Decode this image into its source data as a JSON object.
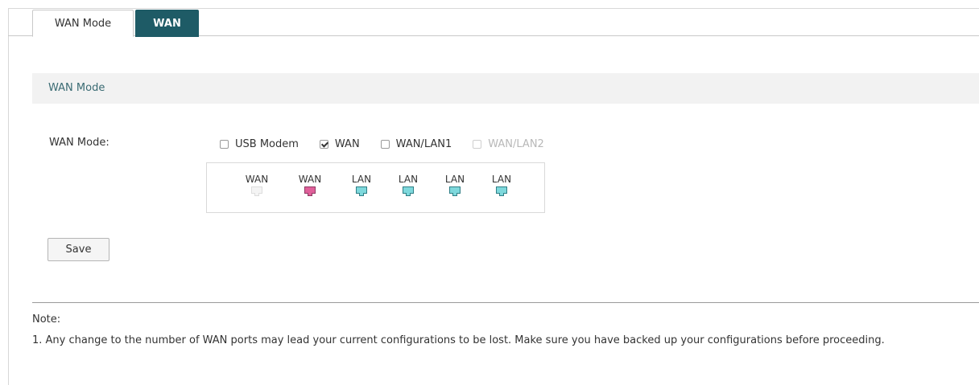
{
  "tabs": [
    {
      "label": "WAN Mode",
      "active": true
    },
    {
      "label": "WAN",
      "active": false
    }
  ],
  "section": {
    "title": "WAN Mode"
  },
  "wan_mode": {
    "label": "WAN Mode:",
    "options": [
      {
        "label": "USB Modem",
        "checked": false,
        "disabled": false
      },
      {
        "label": "WAN",
        "checked": true,
        "disabled": false
      },
      {
        "label": "WAN/LAN1",
        "checked": false,
        "disabled": false
      },
      {
        "label": "WAN/LAN2",
        "checked": false,
        "disabled": true
      }
    ]
  },
  "ports": [
    {
      "label": "WAN",
      "state": "inactive"
    },
    {
      "label": "WAN",
      "state": "wan"
    },
    {
      "label": "LAN",
      "state": "lan"
    },
    {
      "label": "LAN",
      "state": "lan"
    },
    {
      "label": "LAN",
      "state": "lan"
    },
    {
      "label": "LAN",
      "state": "lan"
    }
  ],
  "port_colors": {
    "inactive": {
      "fill": "#f4f4f4",
      "border": "#dddddd"
    },
    "wan": {
      "fill": "#e0609a",
      "border": "#8f3a63"
    },
    "lan": {
      "fill": "#7ed8dc",
      "border": "#2f7f86"
    }
  },
  "colors": {
    "tab_active_bg": "#1e5b66",
    "section_title": "#3a6b73"
  },
  "save_label": "Save",
  "note": {
    "title": "Note:",
    "items": [
      "1. Any change to the number of WAN ports may lead your current configurations to be lost. Make sure you have backed up your configurations before proceeding."
    ]
  }
}
